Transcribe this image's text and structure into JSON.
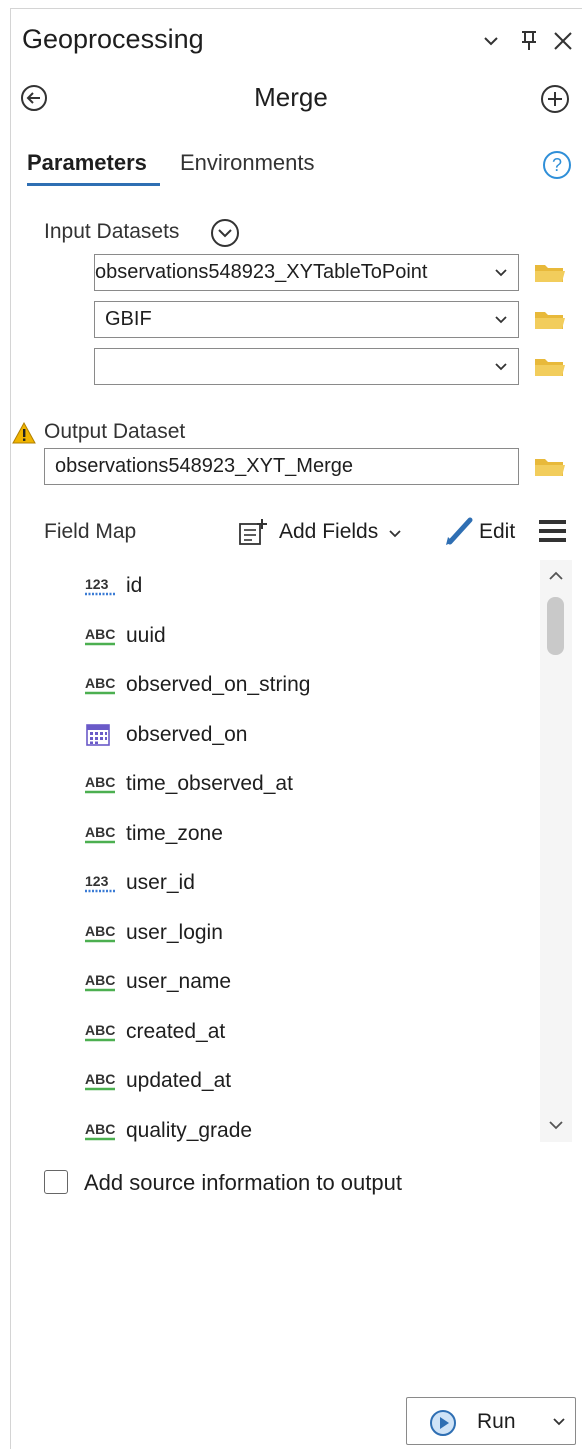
{
  "panel": {
    "title": "Geoprocessing",
    "header_icons": [
      "chevron-down-icon",
      "pin-icon",
      "close-icon"
    ]
  },
  "tool": {
    "name": "Merge",
    "back_icon": "back-arrow-icon",
    "add_icon": "add-circle-icon"
  },
  "tabs": {
    "parameters": "Parameters",
    "environments": "Environments",
    "help_icon": "help-icon"
  },
  "input_datasets": {
    "label": "Input Datasets",
    "values": [
      "observations548923_XYTableToPoint",
      "GBIF",
      ""
    ]
  },
  "output_dataset": {
    "label": "Output Dataset",
    "value": "observations548923_XYT_Merge",
    "warning_icon": "warning-icon"
  },
  "field_map": {
    "label": "Field Map",
    "add_fields_label": "Add Fields",
    "edit_label": "Edit",
    "fields": [
      {
        "type": "number",
        "type_label": "123",
        "name": "id"
      },
      {
        "type": "text",
        "type_label": "ABC",
        "name": "uuid"
      },
      {
        "type": "text",
        "type_label": "ABC",
        "name": "observed_on_string"
      },
      {
        "type": "date",
        "type_label": "",
        "name": "observed_on"
      },
      {
        "type": "text",
        "type_label": "ABC",
        "name": "time_observed_at"
      },
      {
        "type": "text",
        "type_label": "ABC",
        "name": "time_zone"
      },
      {
        "type": "number",
        "type_label": "123",
        "name": "user_id"
      },
      {
        "type": "text",
        "type_label": "ABC",
        "name": "user_login"
      },
      {
        "type": "text",
        "type_label": "ABC",
        "name": "user_name"
      },
      {
        "type": "text",
        "type_label": "ABC",
        "name": "created_at"
      },
      {
        "type": "text",
        "type_label": "ABC",
        "name": "updated_at"
      },
      {
        "type": "text",
        "type_label": "ABC",
        "name": "quality_grade"
      }
    ]
  },
  "options": {
    "add_source_info_label": "Add source information to output",
    "add_source_info_checked": false
  },
  "run": {
    "label": "Run"
  },
  "colors": {
    "accent": "#2f6fb3",
    "folder": "#e8b93a",
    "warning": "#f0b400",
    "text_field_underline": "#4caf50",
    "number_field_underline": "#3a7bd5"
  }
}
